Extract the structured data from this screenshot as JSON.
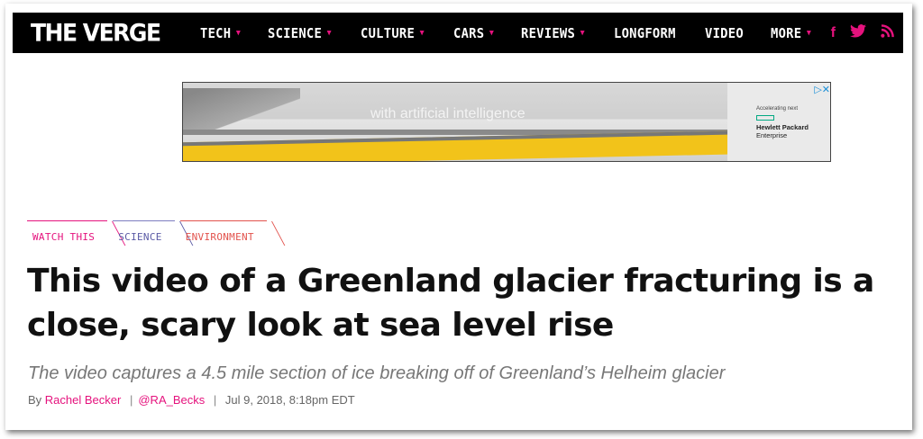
{
  "nav": {
    "logo": "THE VERGE",
    "items": [
      {
        "label": "TECH",
        "dropdown": true
      },
      {
        "label": "SCIENCE",
        "dropdown": true
      },
      {
        "label": "CULTURE",
        "dropdown": true
      },
      {
        "label": "CARS",
        "dropdown": true
      },
      {
        "label": "REVIEWS",
        "dropdown": true
      },
      {
        "label": "LONGFORM",
        "dropdown": false
      },
      {
        "label": "VIDEO",
        "dropdown": false
      },
      {
        "label": "MORE",
        "dropdown": true
      }
    ],
    "social": {
      "facebook": "f",
      "twitter": "🐦",
      "rss": "⟟"
    }
  },
  "ad": {
    "overlay_text": "with artificial intelligence",
    "tagline": "Accelerating next",
    "brand_line1": "Hewlett Packard",
    "brand_line2": "Enterprise",
    "close_glyph": "▷✕"
  },
  "tags": [
    "WATCH THIS",
    "SCIENCE",
    "ENVIRONMENT"
  ],
  "article": {
    "headline": "This video of a Greenland glacier fracturing is a close, scary look at sea level rise",
    "dek": "The video captures a 4.5 mile section of ice breaking off of Greenland’s Helheim glacier",
    "byline_prefix": "By",
    "author": "Rachel Becker",
    "handle": "@RA_Becks",
    "date": "Jul 9, 2018, 8:18pm EDT"
  },
  "colors": {
    "accent": "#e5127d",
    "nav_bg": "#000000"
  }
}
